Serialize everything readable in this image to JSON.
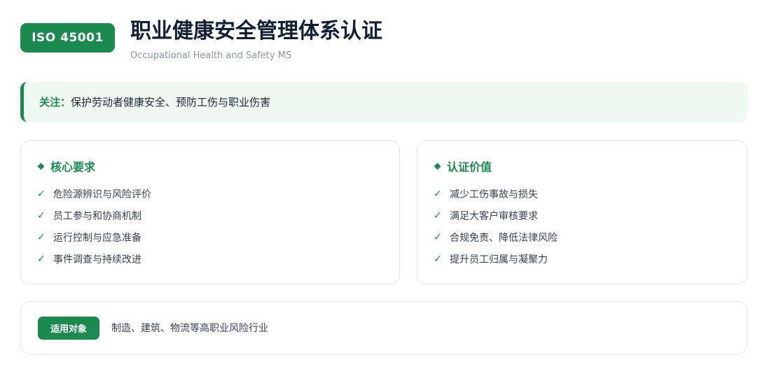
{
  "header": {
    "badge": "ISO 45001",
    "title": "职业健康安全管理体系认证",
    "subtitle": "Occupational Health and Safety MS"
  },
  "focus": {
    "label": "关注：",
    "text": "保护劳动者健康安全、预防工伤与职业伤害"
  },
  "requirements": {
    "title": "核心要求",
    "items": [
      "危险源辨识与风险评价",
      "员工参与和协商机制",
      "运行控制与应急准备",
      "事件调查与持续改进"
    ]
  },
  "value": {
    "title": "认证价值",
    "items": [
      "减少工伤事故与损失",
      "满足大客户审核要求",
      "合规免责、降低法律风险",
      "提升员工归属与凝聚力"
    ]
  },
  "scope": {
    "tag": "适用对象",
    "text": "制造、建筑、物流等高职业风险行业"
  },
  "check_symbol": "✓",
  "colors": {
    "accent": "#1a8a4f",
    "focus_bg": "#f0f8f2",
    "title": "#0f1f36"
  }
}
